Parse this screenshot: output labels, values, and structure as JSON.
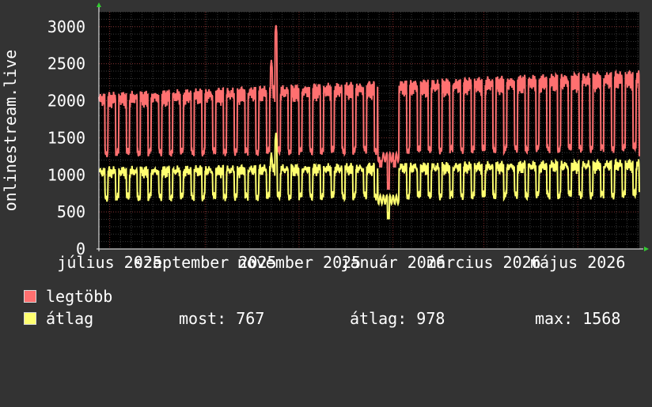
{
  "chart_data": {
    "type": "line",
    "ylabel": "onlinestream.live",
    "ylim": [
      0,
      3200
    ],
    "yticks": [
      0,
      500,
      1000,
      1500,
      2000,
      2500,
      3000
    ],
    "x_start": "2025-06-24",
    "x_end": "2026-06-10",
    "x_tick_labels": [
      {
        "date": "2025-07-01",
        "label": "július 2025"
      },
      {
        "date": "2025-09-01",
        "label": "szeptember 2025"
      },
      {
        "date": "2025-11-01",
        "label": "november 2025"
      },
      {
        "date": "2026-01-01",
        "label": "január 2026"
      },
      {
        "date": "2026-03-01",
        "label": "március 2026"
      },
      {
        "date": "2026-05-01",
        "label": "május 2026"
      }
    ],
    "grid": true,
    "series": [
      {
        "name": "legtöbb",
        "color": "#ff7070",
        "weekday_level": 2050,
        "weekend_level": 1300,
        "trend_end_level": 2350,
        "events": [
          {
            "date": "2025-10-17",
            "value": 3020
          },
          {
            "date": "2025-10-14",
            "value": 2550
          },
          {
            "date": "2025-12-24",
            "value": 1200
          },
          {
            "date": "2025-12-29",
            "value": 900
          },
          {
            "date": "2026-01-02",
            "value": 1200
          }
        ],
        "last_value": 1250
      },
      {
        "name": "átlag",
        "color": "#ffff70",
        "weekday_level": 1050,
        "weekend_level": 700,
        "trend_end_level": 1150,
        "events": [
          {
            "date": "2025-10-17",
            "value": 1568
          },
          {
            "date": "2025-10-14",
            "value": 1300
          },
          {
            "date": "2025-12-29",
            "value": 500
          }
        ],
        "last_value": 767
      }
    ]
  },
  "legend": {
    "items": [
      {
        "label": "legtöbb",
        "color": "#ff7070"
      },
      {
        "label": "átlag",
        "color": "#ffff70"
      }
    ],
    "stats": {
      "now": "most: 767",
      "avg": "átlag: 978",
      "max": "max: 1568"
    }
  }
}
